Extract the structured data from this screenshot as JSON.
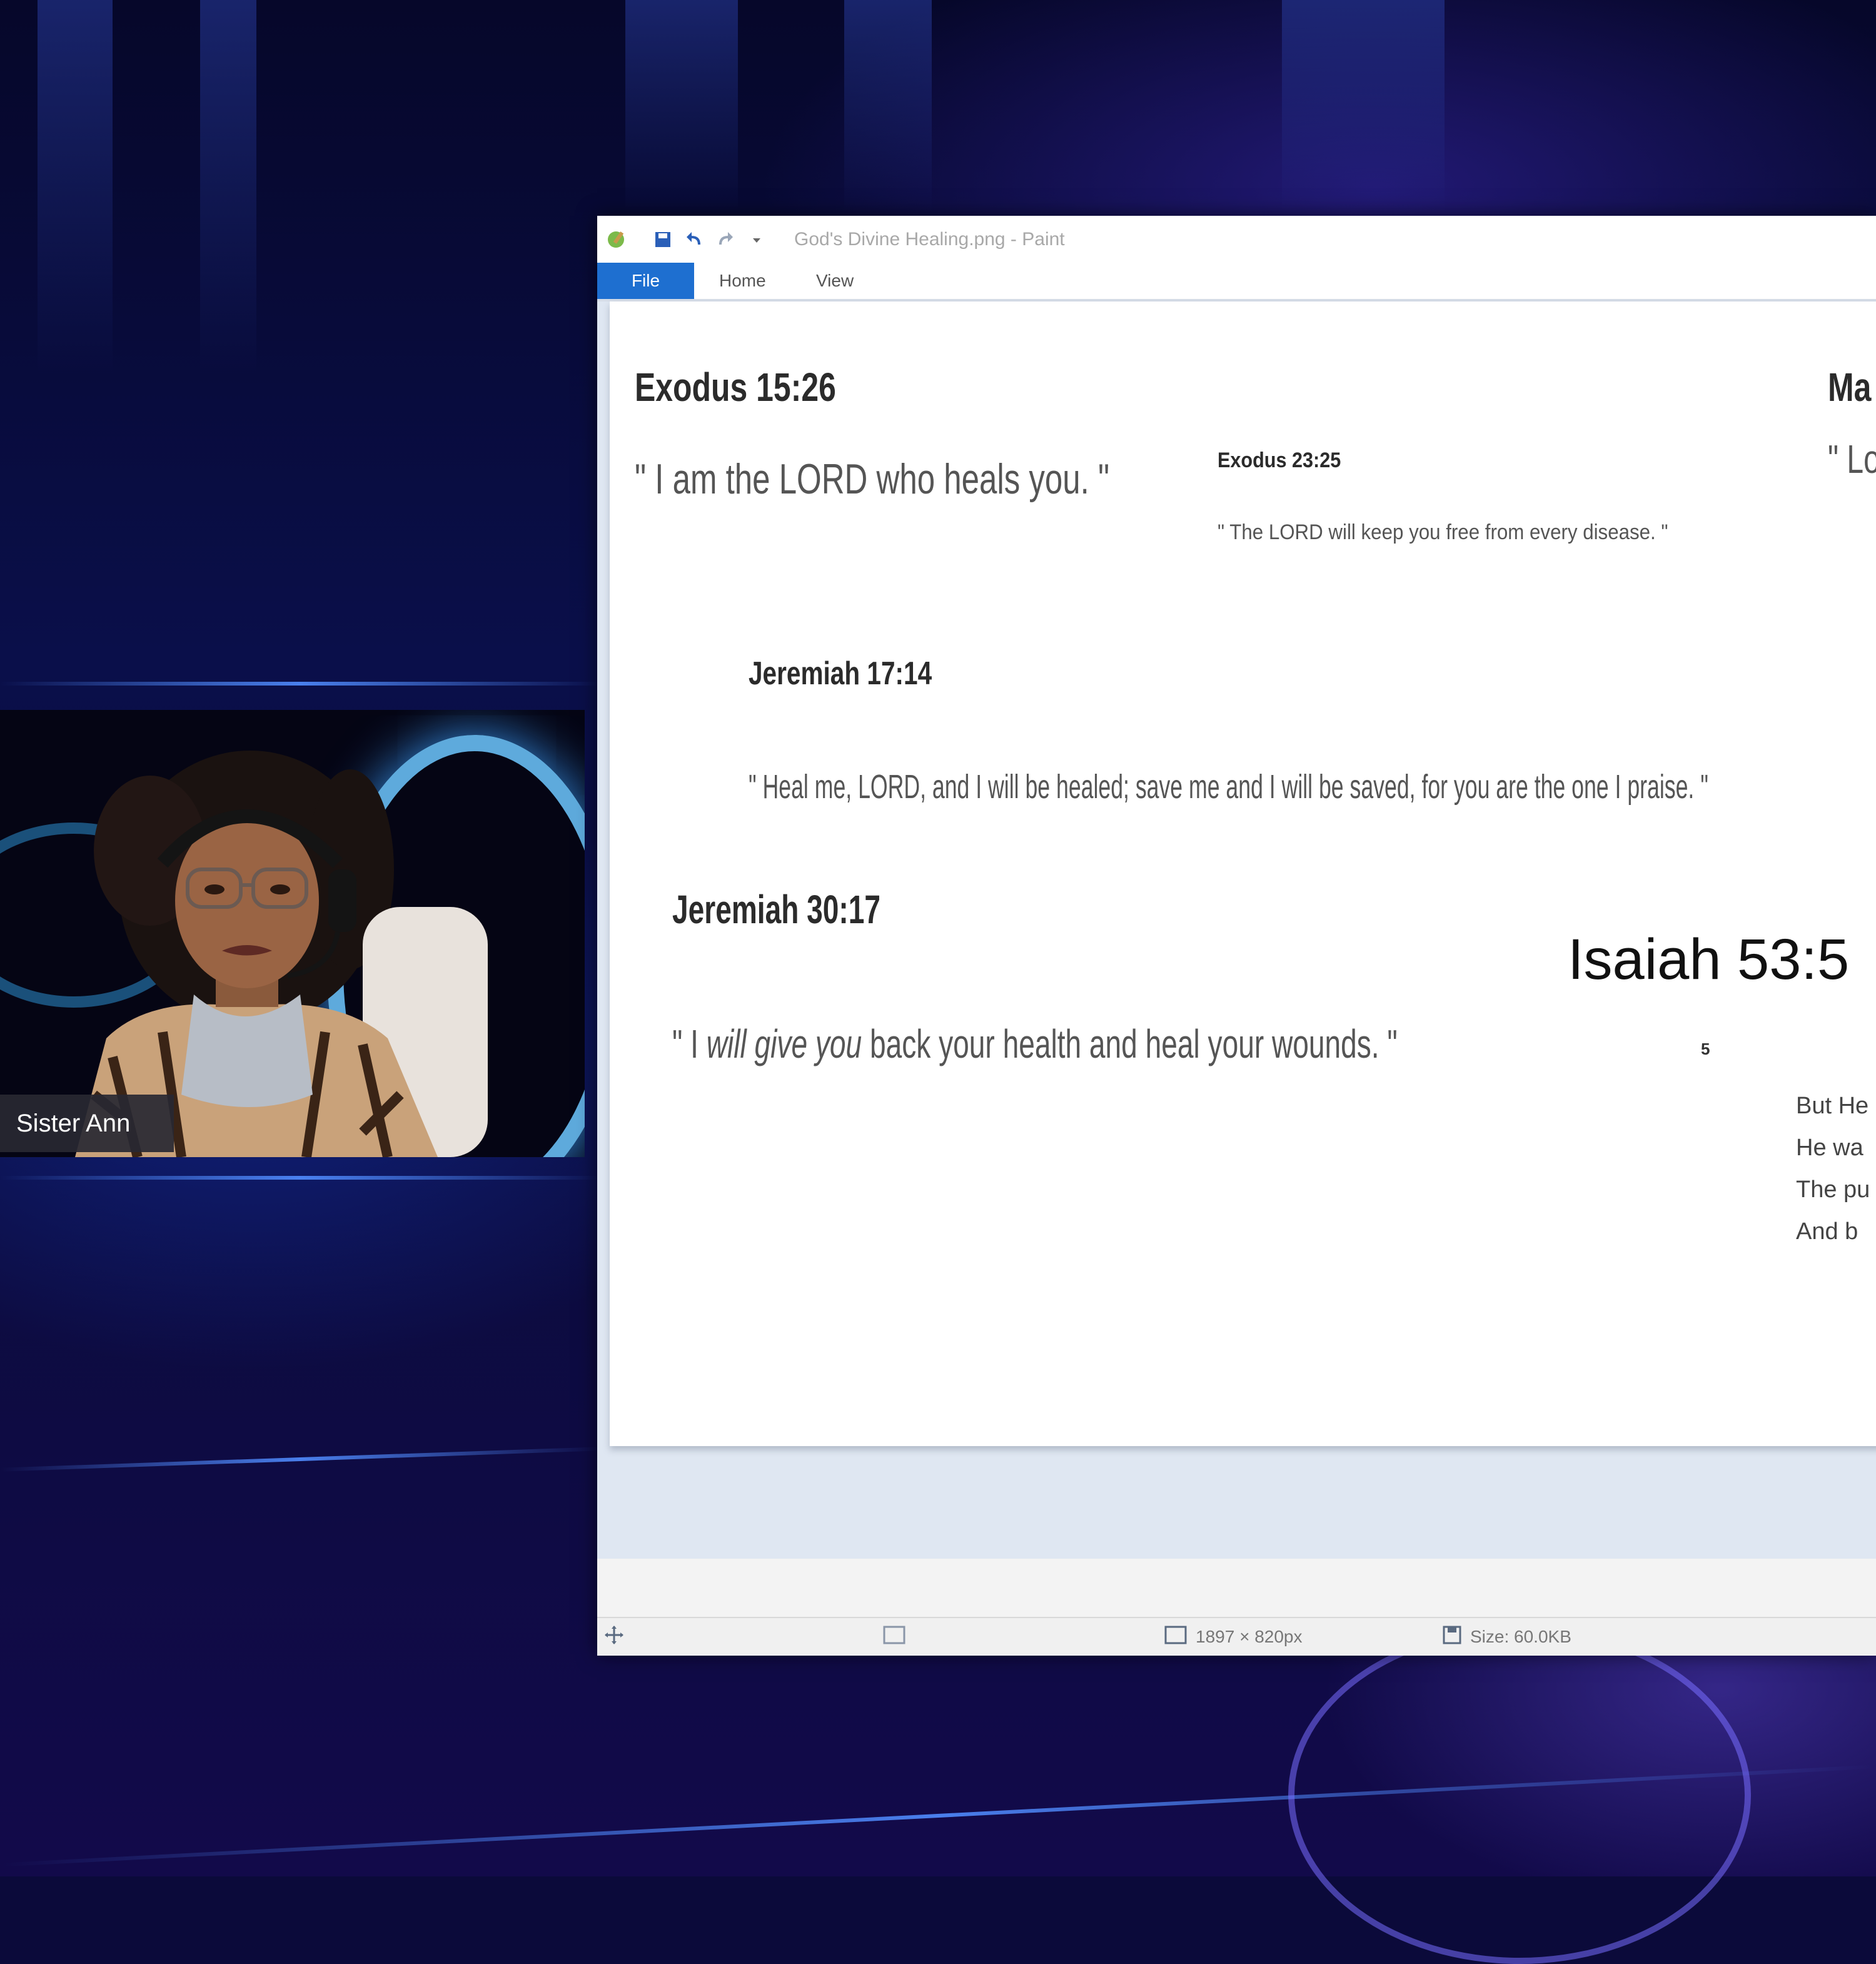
{
  "participant": {
    "name": "Sister Ann"
  },
  "paint": {
    "title": "God's Divine Healing.png - Paint",
    "tabs": [
      "File",
      "Home",
      "View"
    ],
    "status": {
      "dimensions": "1897 × 820px",
      "size": "Size: 60.0KB"
    }
  },
  "slide": {
    "exodus_15_26": {
      "reference": "Exodus 15:26",
      "verse": "\" I am the LORD who heals you. \""
    },
    "exodus_23_25": {
      "reference": "Exodus 23:25",
      "verse": "\" The LORD will keep you free from every disease. \""
    },
    "matthew_partial": {
      "reference": "Ma",
      "verse": "\" Lo"
    },
    "jeremiah_17_14": {
      "reference": "Jeremiah 17:14",
      "verse": "\" Heal me, LORD, and I will be healed; save me and I will be saved, for you are the one I praise. \""
    },
    "jeremiah_30_17": {
      "reference": "Jeremiah 30:17",
      "verse_open": "\" I ",
      "verse_italic": "will give you",
      "verse_rest": " back your health and heal your wounds. \""
    },
    "isaiah_53_5": {
      "reference": "Isaiah 53:5",
      "verse_number": "5",
      "lines": [
        "But He",
        "He wa",
        "The pu",
        "And b"
      ]
    }
  }
}
